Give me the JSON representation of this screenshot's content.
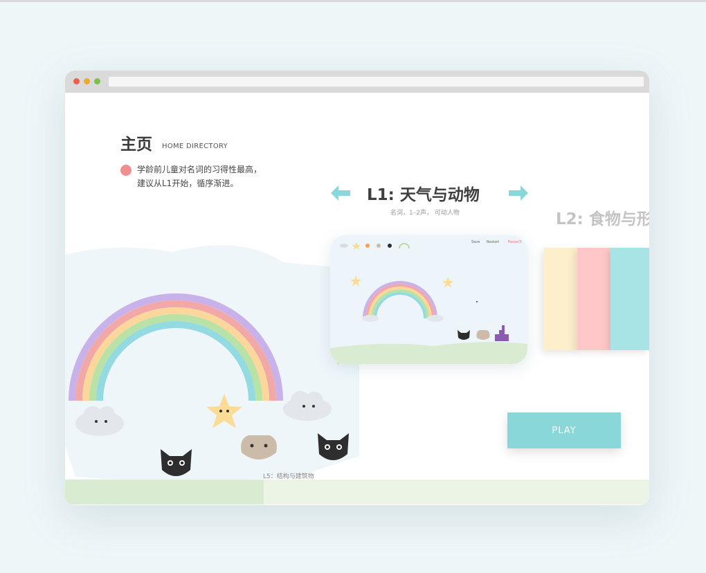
{
  "page": {
    "title": "主页",
    "subtitle": "HOME DIRECTORY",
    "description_line1": "学龄前儿童对名词的习得性最高，",
    "description_line2": "建议从L1开始，循序渐进。"
  },
  "current_level": {
    "title": "L1: 天气与动物",
    "subtitle": "名词，1–2声， 可动人物"
  },
  "next_level": {
    "title": "L2: 食物与形"
  },
  "preview": {
    "nav": [
      "Save",
      "Restart",
      "Pause/X"
    ],
    "nav_accent_color": "#e6757a"
  },
  "swatches": [
    "#fdeecc",
    "#ffc7c8",
    "#a8e4e6"
  ],
  "play_button": {
    "label": "PLAY"
  },
  "footer": {
    "level_label": "L5：结构与建筑物",
    "progress_fraction": 0.34
  },
  "colors": {
    "accent_teal": "#8ad7da",
    "bullet_pink": "#ef8f8f",
    "window_dot_red": "#ec5f4f",
    "window_dot_yellow": "#f0a830",
    "window_dot_green": "#7dc04a"
  },
  "icons": [
    "arrow-left-icon",
    "arrow-right-icon",
    "rainbow-icon",
    "star-icon",
    "cloud-icon",
    "cat-icon",
    "dog-icon"
  ]
}
